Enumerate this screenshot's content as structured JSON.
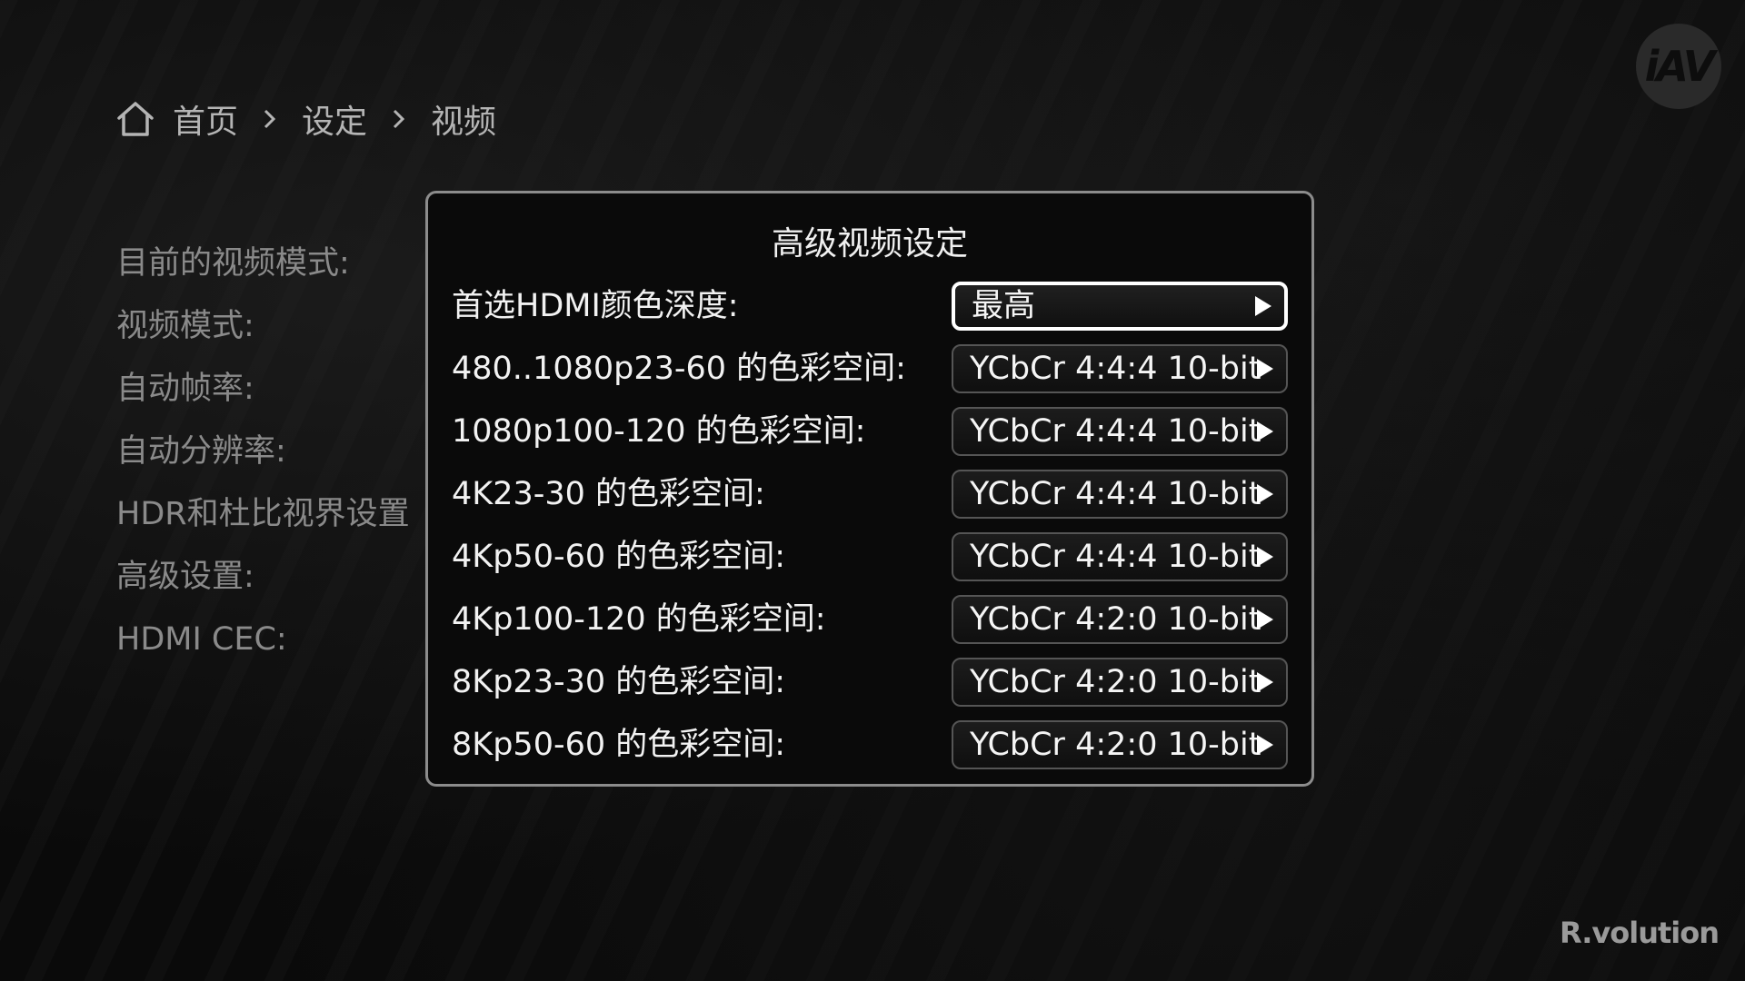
{
  "breadcrumb": {
    "items": [
      "首页",
      "设定",
      "视频"
    ]
  },
  "logo": {
    "iav": "iAV",
    "brand": "R.volution"
  },
  "left_menu": {
    "items": [
      "目前的视频模式:",
      "视频模式:",
      "自动帧率:",
      "自动分辨率:",
      "HDR和杜比视界设置",
      "高级设置:",
      "HDMI CEC:"
    ]
  },
  "dialog": {
    "title": "高级视频设定",
    "rows": [
      {
        "label": "首选HDMI颜色深度:",
        "value": "最高",
        "focused": true
      },
      {
        "label": "480..1080p23-60 的色彩空间:",
        "value": "YCbCr 4:4:4 10-bit"
      },
      {
        "label": "1080p100-120 的色彩空间:",
        "value": "YCbCr 4:4:4 10-bit"
      },
      {
        "label": "4K23-30 的色彩空间:",
        "value": "YCbCr 4:4:4 10-bit"
      },
      {
        "label": "4Kp50-60 的色彩空间:",
        "value": "YCbCr 4:4:4 10-bit"
      },
      {
        "label": "4Kp100-120 的色彩空间:",
        "value": "YCbCr 4:2:0 10-bit"
      },
      {
        "label": "8Kp23-30 的色彩空间:",
        "value": "YCbCr 4:2:0 10-bit"
      },
      {
        "label": "8Kp50-60 的色彩空间:",
        "value": "YCbCr 4:2:0 10-bit"
      }
    ]
  },
  "icons": {
    "home": "home-icon",
    "separator": "chevron-right-icon",
    "value_arrow": "play-arrow-icon"
  },
  "colors": {
    "background": "#0a0a0a",
    "focus_border": "#ffffff",
    "dialog_border": "#8c8c8c",
    "dim_text": "#8a8a8a"
  }
}
